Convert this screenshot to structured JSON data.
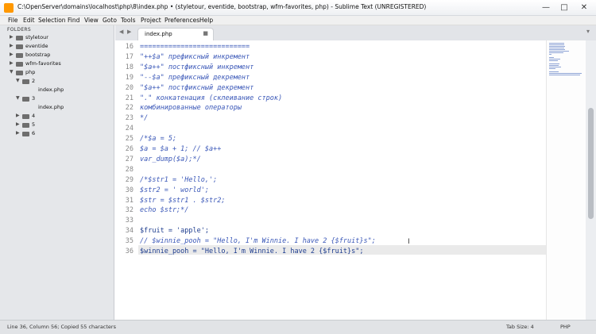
{
  "window": {
    "title": "C:\\OpenServer\\domains\\localhost\\php\\8\\index.php • (styletour, eventide, bootstrap, wfm-favorites, php) - Sublime Text (UNREGISTERED)",
    "minimize": "—",
    "maximize": "□",
    "close": "✕"
  },
  "menu": [
    "File",
    "Edit",
    "Selection",
    "Find",
    "View",
    "Goto",
    "Tools",
    "Project",
    "Preferences",
    "Help"
  ],
  "sidebar": {
    "header": "FOLDERS",
    "items": [
      {
        "label": "styletour",
        "arrow": "▶"
      },
      {
        "label": "eventide",
        "arrow": "▶"
      },
      {
        "label": "bootstrap",
        "arrow": "▶"
      },
      {
        "label": "wfm-favorites",
        "arrow": "▶"
      },
      {
        "label": "php",
        "arrow": "▼"
      },
      {
        "label": "2",
        "arrow": "▼"
      },
      {
        "label": "index.php",
        "arrow": ""
      },
      {
        "label": "3",
        "arrow": "▼"
      },
      {
        "label": "index.php",
        "arrow": ""
      },
      {
        "label": "4",
        "arrow": "▶"
      },
      {
        "label": "5",
        "arrow": "▶"
      },
      {
        "label": "6",
        "arrow": "▶"
      }
    ]
  },
  "tabs": {
    "back": "◀",
    "forward": "▶",
    "active_label": "index.php",
    "close_glyph": "■",
    "overflow": "▾"
  },
  "editor": {
    "lines": [
      {
        "num": "16",
        "text": "===========================",
        "color": "#3b58b8",
        "italic": true
      },
      {
        "num": "17",
        "text": "\"++$a\" префиксный инкремент",
        "color": "#3b58b8",
        "italic": true
      },
      {
        "num": "18",
        "text": "\"$a++\" постфиксный инкремент",
        "color": "#3b58b8",
        "italic": true
      },
      {
        "num": "19",
        "text": "\"--$a\" префиксный декремент",
        "color": "#3b58b8",
        "italic": true
      },
      {
        "num": "20",
        "text": "\"$a++\" постфиксный декремент",
        "color": "#3b58b8",
        "italic": true
      },
      {
        "num": "21",
        "text": "\".\" конкатенация (склеивание строк)",
        "color": "#3b58b8",
        "italic": true
      },
      {
        "num": "22",
        "text": "комбинированные операторы",
        "color": "#3b58b8",
        "italic": true
      },
      {
        "num": "23",
        "text": "*/",
        "color": "#3b58b8",
        "italic": true
      },
      {
        "num": "24",
        "text": "",
        "color": "#3b58b8",
        "italic": true
      },
      {
        "num": "25",
        "text": "/*$a = 5;",
        "color": "#3b58b8",
        "italic": true
      },
      {
        "num": "26",
        "text": "$a = $a + 1; // $a++",
        "color": "#3b58b8",
        "italic": true
      },
      {
        "num": "27",
        "text": "var_dump($a);*/",
        "color": "#3b58b8",
        "italic": true
      },
      {
        "num": "28",
        "text": "",
        "color": "#3b58b8",
        "italic": true
      },
      {
        "num": "29",
        "text": "/*$str1 = 'Hello,';",
        "color": "#3b58b8",
        "italic": true
      },
      {
        "num": "30",
        "text": "$str2 = ' world';",
        "color": "#3b58b8",
        "italic": true
      },
      {
        "num": "31",
        "text": "$str = $str1 . $str2;",
        "color": "#3b58b8",
        "italic": true
      },
      {
        "num": "32",
        "text": "echo $str;*/",
        "color": "#3b58b8",
        "italic": true
      },
      {
        "num": "33",
        "text": "",
        "color": "#3b58b8",
        "italic": true
      },
      {
        "num": "34",
        "text": "$fruit = 'apple';",
        "color": "#1e3d8f",
        "italic": false
      },
      {
        "num": "35",
        "text": "// $winnie_pooh = \"Hello, I'm Winnie. I have 2 {$fruit}s\";",
        "color": "#3b58b8",
        "italic": true
      },
      {
        "num": "36",
        "text": "$winnie_pooh = \"Hello, I'm Winnie. I have 2 {$fruit}s\";",
        "color": "#1e3d8f",
        "italic": false
      }
    ],
    "text_cursor": "I"
  },
  "status": {
    "left": "Line 36, Column 56; Copied 55 characters",
    "tab_size": "Tab Size: 4",
    "syntax": "PHP"
  }
}
